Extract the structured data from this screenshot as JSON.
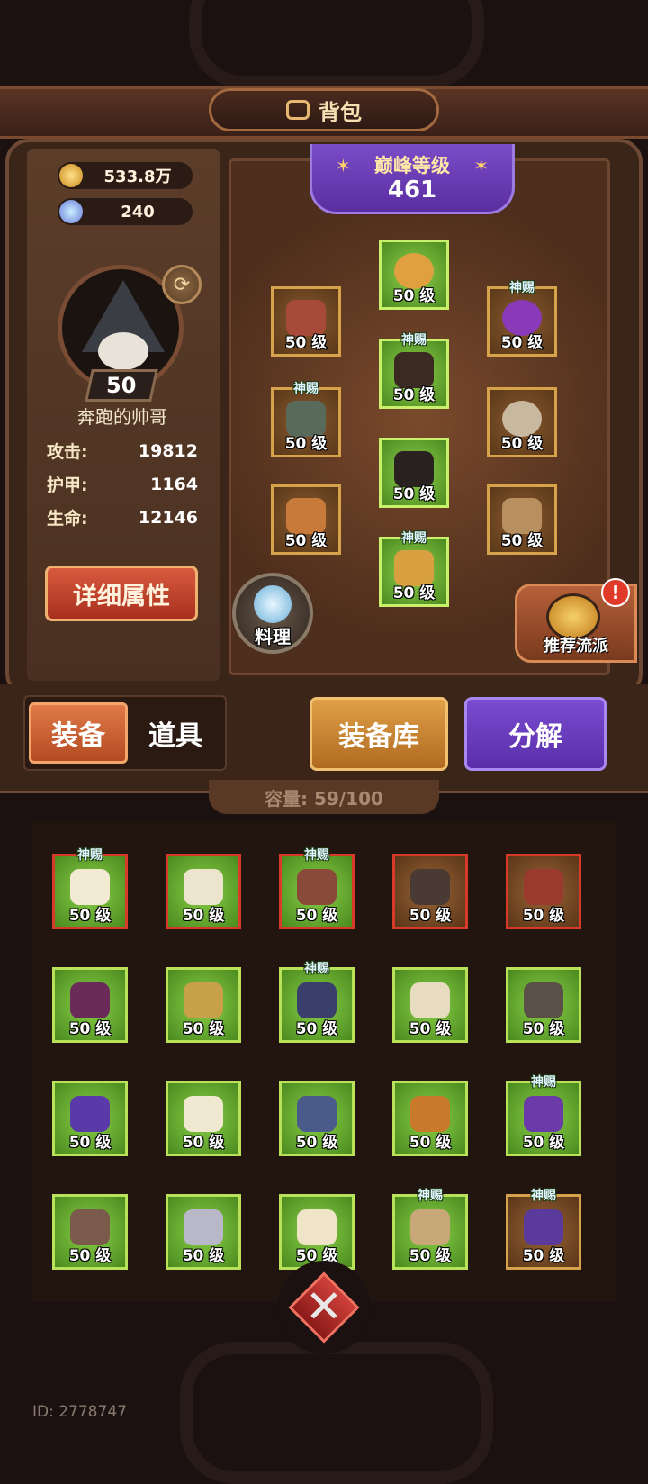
{
  "header": {
    "title": "背包"
  },
  "currency": {
    "gold": "533.8万",
    "gems": "240"
  },
  "player": {
    "level": "50",
    "name": "奔跑的帅哥"
  },
  "stats": [
    {
      "label": "攻击:",
      "value": "19812"
    },
    {
      "label": "护甲:",
      "value": "1164"
    },
    {
      "label": "生命:",
      "value": "12146"
    }
  ],
  "buttons": {
    "detail": "详细属性",
    "cook": "料理",
    "recommend": "推荐流派",
    "alert": "!"
  },
  "peak": {
    "title": "巅峰等级",
    "level": "461"
  },
  "equipped": [
    {
      "level": "50 级",
      "tag": "",
      "slot": "weapon-top"
    },
    {
      "level": "50 级",
      "tag": "",
      "slot": "helmet"
    },
    {
      "level": "50 级",
      "tag": "神赐",
      "slot": "necklace"
    },
    {
      "level": "50 级",
      "tag": "神赐",
      "slot": "chest"
    },
    {
      "level": "50 级",
      "tag": "神赐",
      "slot": "gloves"
    },
    {
      "level": "50 级",
      "tag": "",
      "slot": "ring"
    },
    {
      "level": "50 级",
      "tag": "",
      "slot": "pants"
    },
    {
      "level": "50 级",
      "tag": "",
      "slot": "weapon"
    },
    {
      "level": "50 级",
      "tag": "",
      "slot": "bracer"
    },
    {
      "level": "50 级",
      "tag": "神赐",
      "slot": "boots"
    }
  ],
  "tabs": {
    "equipment": "装备",
    "items": "道具",
    "storage": "装备库",
    "disassemble": "分解"
  },
  "capacity": "容量: 59/100",
  "inventory": [
    {
      "level": "50 级",
      "tag": "神赐"
    },
    {
      "level": "50 级",
      "tag": ""
    },
    {
      "level": "50 级",
      "tag": "神赐"
    },
    {
      "level": "50 级",
      "tag": ""
    },
    {
      "level": "50 级",
      "tag": ""
    },
    {
      "level": "50 级",
      "tag": ""
    },
    {
      "level": "50 级",
      "tag": ""
    },
    {
      "level": "50 级",
      "tag": "神赐"
    },
    {
      "level": "50 级",
      "tag": ""
    },
    {
      "level": "50 级",
      "tag": ""
    },
    {
      "level": "50 级",
      "tag": ""
    },
    {
      "level": "50 级",
      "tag": ""
    },
    {
      "level": "50 级",
      "tag": ""
    },
    {
      "level": "50 级",
      "tag": ""
    },
    {
      "level": "50 级",
      "tag": "神赐"
    },
    {
      "level": "50 级",
      "tag": ""
    },
    {
      "level": "50 级",
      "tag": ""
    },
    {
      "level": "50 级",
      "tag": ""
    },
    {
      "level": "50 级",
      "tag": "神赐"
    },
    {
      "level": "50 级",
      "tag": "神赐"
    }
  ],
  "footer": {
    "uid": "ID: 2778747"
  },
  "colors": {
    "accent_green": "#8ad048",
    "accent_purple": "#6a3cb8",
    "accent_orange": "#d0702e",
    "gold_border": "#d6a34a"
  }
}
